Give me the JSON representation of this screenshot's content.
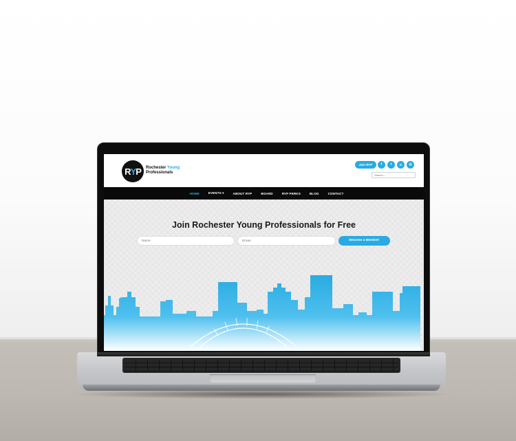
{
  "site": {
    "logo_mark": {
      "left": "R",
      "middle": "Y",
      "right": "P"
    },
    "logo_line1": "Rochester",
    "logo_line1_accent": "Young",
    "logo_line2": "Professionals",
    "join_label": "Join RYP",
    "social": [
      {
        "icon": "facebook-icon",
        "glyph": "f"
      },
      {
        "icon": "twitter-icon",
        "glyph": "t"
      },
      {
        "icon": "linkedin-icon",
        "glyph": "in"
      },
      {
        "icon": "instagram-icon",
        "glyph": "◎"
      }
    ],
    "search_placeholder": "Search...",
    "nav": [
      {
        "label": "HOME",
        "active": true
      },
      {
        "label": "EVENTS ▾",
        "active": false
      },
      {
        "label": "ABOUT RYP",
        "active": false
      },
      {
        "label": "BOARD",
        "active": false
      },
      {
        "label": "RYP PERKS",
        "active": false
      },
      {
        "label": "BLOG",
        "active": false
      },
      {
        "label": "CONTACT",
        "active": false
      }
    ],
    "hero": {
      "title": "Join Rochester Young Professionals for Free",
      "name_placeholder": "Name",
      "email_placeholder": "Email",
      "cta_label": "Become a Member!"
    },
    "colors": {
      "accent": "#29abe2",
      "nav_bg": "#0a0a0a",
      "text_dark": "#1a1a1a"
    }
  }
}
